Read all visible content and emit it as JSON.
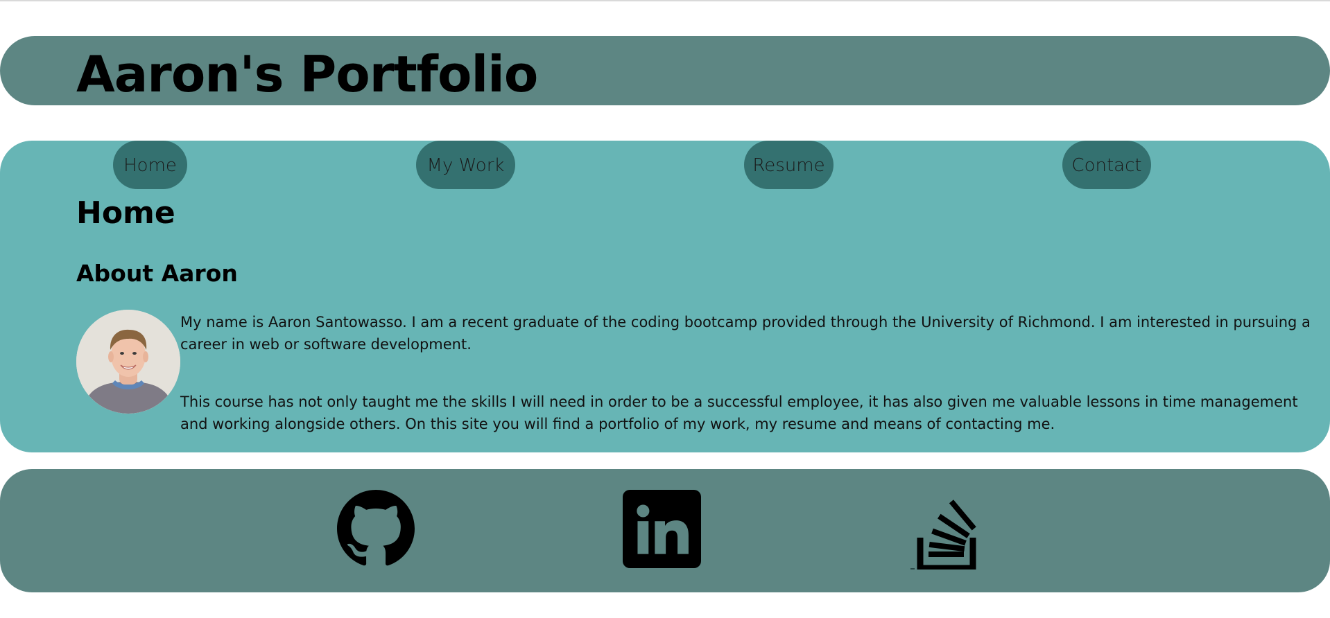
{
  "header": {
    "title": "Aaron's Portfolio"
  },
  "nav": {
    "items": [
      {
        "label": "Home"
      },
      {
        "label": "My Work"
      },
      {
        "label": "Resume"
      },
      {
        "label": "Contact"
      }
    ]
  },
  "main": {
    "heading": "Home",
    "section_title": "About Aaron",
    "paragraphs": [
      "My name is Aaron Santowasso. I am a recent graduate of the coding bootcamp provided through the University of Richmond. I am interested in pursuing a career in web or software development.",
      "This course has not only taught me the skills I will need in order to be a successful employee, it has also given me valuable lessons in time management and working alongside others. On this site you will find a portfolio of my work, my resume and means of contacting me."
    ]
  },
  "footer": {
    "links": [
      {
        "icon": "github-icon"
      },
      {
        "icon": "linkedin-icon"
      },
      {
        "icon": "stackoverflow-icon"
      }
    ]
  },
  "colors": {
    "header_bg": "#5d8683",
    "main_bg": "#67b5b5",
    "nav_pill_bg": "#347170",
    "footer_bg": "#5d8683"
  }
}
